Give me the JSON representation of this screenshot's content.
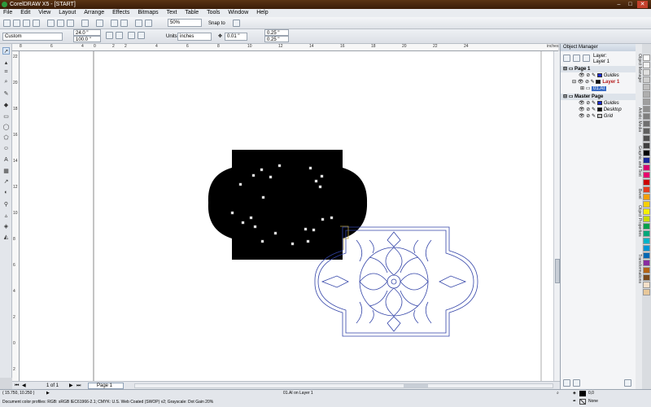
{
  "window": {
    "title": "CorelDRAW X5 - [START]",
    "min": "–",
    "max": "□",
    "close": "✕"
  },
  "menu": [
    "File",
    "Edit",
    "View",
    "Layout",
    "Arrange",
    "Effects",
    "Bitmaps",
    "Text",
    "Table",
    "Tools",
    "Window",
    "Help"
  ],
  "toolbar": {
    "zoom_value": "50%",
    "snap_label": "Snap to"
  },
  "property_bar": {
    "page_preset": "Custom",
    "width_value": "24.0 \"",
    "height_value": "100.0 \"",
    "units_label": "Units:",
    "units_value": "inches",
    "nudge_value": "0.01 \"",
    "dup_x": "0.25 \"",
    "dup_y": "0.25 \""
  },
  "ruler_top_numbers": [
    "8",
    "6",
    "4",
    "2",
    "0",
    "2",
    "4",
    "6",
    "8",
    "10",
    "12",
    "14",
    "16",
    "18",
    "20",
    "22",
    "24"
  ],
  "ruler_top_unit": "inches",
  "ruler_left_numbers": [
    "22",
    "20",
    "18",
    "16",
    "14",
    "12",
    "10",
    "8",
    "6",
    "4",
    "2",
    "0",
    "2"
  ],
  "object_manager": {
    "title": "Object Manager",
    "layer_label": "Layer:",
    "current_layer": "Layer 1",
    "page_label": "Page 1",
    "rows": [
      {
        "name": "Guides",
        "color": "#1a2bd6",
        "style": "italic"
      },
      {
        "name": "Layer 1",
        "color": "#b31818",
        "style": "bold-red"
      },
      {
        "name": "01.AI",
        "color": "#2a4cc6",
        "style": "selected"
      }
    ],
    "master_label": "Master Page",
    "master_rows": [
      {
        "name": "Guides",
        "color": "#1a2bd6"
      },
      {
        "name": "Desktop",
        "color": "#111111"
      },
      {
        "name": "Grid",
        "color": "#c8c8c8"
      }
    ]
  },
  "docker_tabs": [
    "Object Manager",
    "Artistic Media",
    "Graphic and Text",
    "Bevel",
    "Object Properties",
    "Transformations"
  ],
  "palette_colors": [
    "#ffffff",
    "#f0f0f0",
    "#e0e0e0",
    "#cfcfcf",
    "#bfbfbf",
    "#afafaf",
    "#9f9f9f",
    "#8f8f8f",
    "#7f7f7f",
    "#6f6f6f",
    "#5f5f5f",
    "#4f4f4f",
    "#3f3f3f",
    "#000000",
    "#1a2a9a",
    "#d6006e",
    "#e8006e",
    "#cc0000",
    "#e63c1e",
    "#f4a000",
    "#f7d000",
    "#f5f000",
    "#c8dc00",
    "#00a14b",
    "#00a87a",
    "#00b4c8",
    "#0096d6",
    "#0068b4",
    "#8a2ca0",
    "#b46414",
    "#7a4a1c",
    "#f4e0c8",
    "#e8c89a"
  ],
  "status": {
    "coords": "( 15.750, 10.250 )",
    "object_info": "01.AI on Layer 1",
    "color_profiles": "Document color profiles: RGB: sRGB IEC61966-2.1; CMYK: U.S. Web Coated (SWOP) v2; Grayscale: Dot Gain 20%",
    "fill_value": "0,0",
    "outline_value": "None"
  },
  "page_nav": {
    "count": "1 of 1",
    "tab": "Page 1"
  }
}
